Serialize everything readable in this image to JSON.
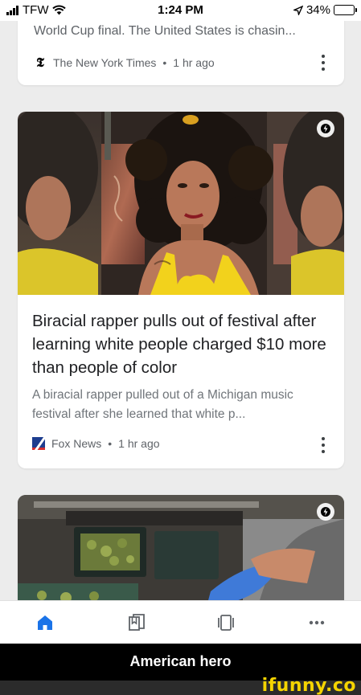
{
  "status_bar": {
    "carrier": "TFW",
    "time": "1:24 PM",
    "battery": "34%",
    "battery_level": 0.34,
    "icons": [
      "signal-icon",
      "wifi-icon",
      "location-arrow-icon",
      "battery-icon"
    ]
  },
  "cards": [
    {
      "snippet": "World Cup final. The United States is chasin...",
      "source": "The New York Times",
      "time_ago": "1 hr ago",
      "source_logo": "𝕿"
    },
    {
      "image_description": "woman-photo",
      "headline": "Biracial rapper pulls out of festival after learning white people charged $10 more than people of color",
      "description": "A biracial rapper pulled out of a Michigan music festival after she learned that white p...",
      "source": "Fox News",
      "time_ago": "1 hr ago"
    },
    {
      "image_description": "kitchen-photo"
    }
  ],
  "separator": "•",
  "bottom_nav": {
    "items": [
      "home-icon",
      "saved-icon",
      "tabs-icon",
      "more-icon"
    ],
    "active_color": "#1a73e8",
    "inactive_color": "#5f6368"
  },
  "caption": "American hero",
  "watermark": "ifunny.co",
  "colors": {
    "shirt_yellow": "#f2d21c",
    "hair": "#1b1410",
    "skin": "#b9785a"
  }
}
